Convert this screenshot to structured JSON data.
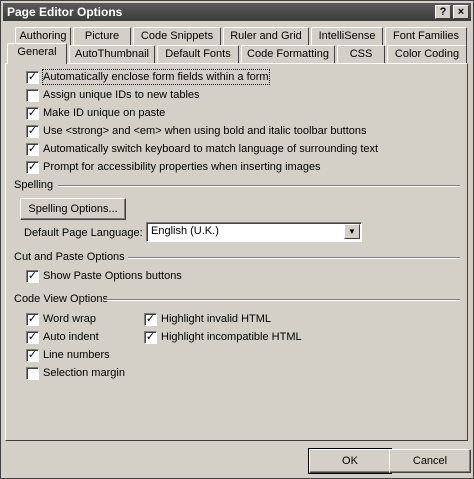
{
  "window": {
    "title": "Page Editor Options",
    "help_label": "?",
    "close_label": "×"
  },
  "tabs_row1": [
    "Authoring",
    "Picture",
    "Code Snippets",
    "Ruler and Grid",
    "IntelliSense",
    "Font Families"
  ],
  "tabs_row2": [
    "General",
    "AutoThumbnail",
    "Default Fonts",
    "Code Formatting",
    "CSS",
    "Color Coding"
  ],
  "active_tab": "General",
  "general_options": [
    {
      "label": "Automatically enclose form fields within a form",
      "checked": true
    },
    {
      "label": "Assign unique IDs to new tables",
      "checked": false
    },
    {
      "label": "Make ID unique on paste",
      "checked": true
    },
    {
      "label": "Use <strong> and <em> when using bold and italic toolbar buttons",
      "checked": true
    },
    {
      "label": "Automatically switch keyboard to match language of surrounding text",
      "checked": true
    },
    {
      "label": "Prompt for accessibility properties when inserting images",
      "checked": true
    }
  ],
  "spelling": {
    "section_label": "Spelling",
    "button_label": "Spelling Options...",
    "language_label": "Default Page Language:",
    "language_value": "English (U.K.)"
  },
  "cut_paste": {
    "section_label": "Cut and Paste Options",
    "show_paste_label": "Show Paste Options buttons",
    "show_paste_checked": true
  },
  "code_view": {
    "section_label": "Code View Options",
    "left": [
      {
        "label": "Word wrap",
        "checked": true
      },
      {
        "label": "Auto indent",
        "checked": true
      },
      {
        "label": "Line numbers",
        "checked": true
      },
      {
        "label": "Selection margin",
        "checked": false
      }
    ],
    "right": [
      {
        "label": "Highlight invalid HTML",
        "checked": true
      },
      {
        "label": "Highlight incompatible HTML",
        "checked": true
      }
    ]
  },
  "footer": {
    "ok_label": "OK",
    "cancel_label": "Cancel"
  },
  "colors": {
    "dialog_bg": "#d4d0c8",
    "titlebar": "#3c3c3c"
  }
}
